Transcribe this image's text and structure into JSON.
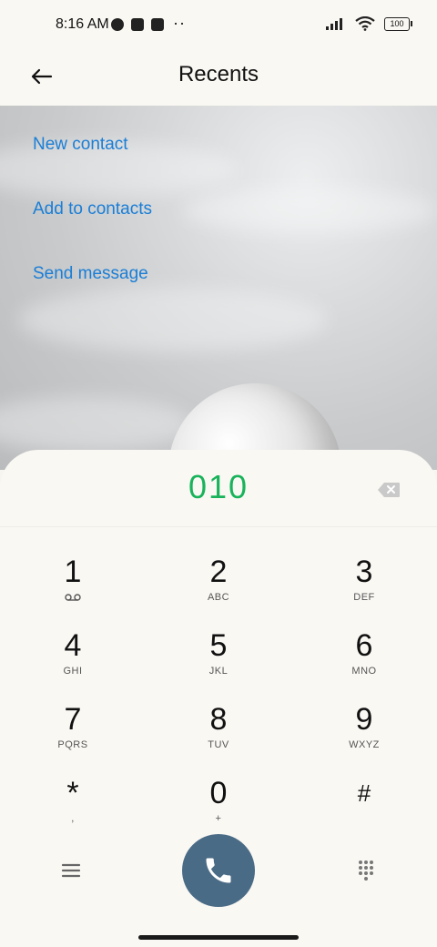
{
  "status": {
    "time": "8:16 AM",
    "battery": "100"
  },
  "appbar": {
    "title": "Recents"
  },
  "actions": [
    {
      "label": "New contact"
    },
    {
      "label": "Add to contacts"
    },
    {
      "label": "Send message"
    }
  ],
  "dialer": {
    "number": "010",
    "keys": [
      {
        "digit": "1",
        "letters": ""
      },
      {
        "digit": "2",
        "letters": "ABC"
      },
      {
        "digit": "3",
        "letters": "DEF"
      },
      {
        "digit": "4",
        "letters": "GHI"
      },
      {
        "digit": "5",
        "letters": "JKL"
      },
      {
        "digit": "6",
        "letters": "MNO"
      },
      {
        "digit": "7",
        "letters": "PQRS"
      },
      {
        "digit": "8",
        "letters": "TUV"
      },
      {
        "digit": "9",
        "letters": "WXYZ"
      },
      {
        "digit": "*",
        "letters": ","
      },
      {
        "digit": "0",
        "letters": "+"
      },
      {
        "digit": "#",
        "letters": ""
      }
    ]
  },
  "colors": {
    "accent_link": "#1a7ed6",
    "number_green": "#19b35b",
    "call_button": "#4a6b86"
  }
}
